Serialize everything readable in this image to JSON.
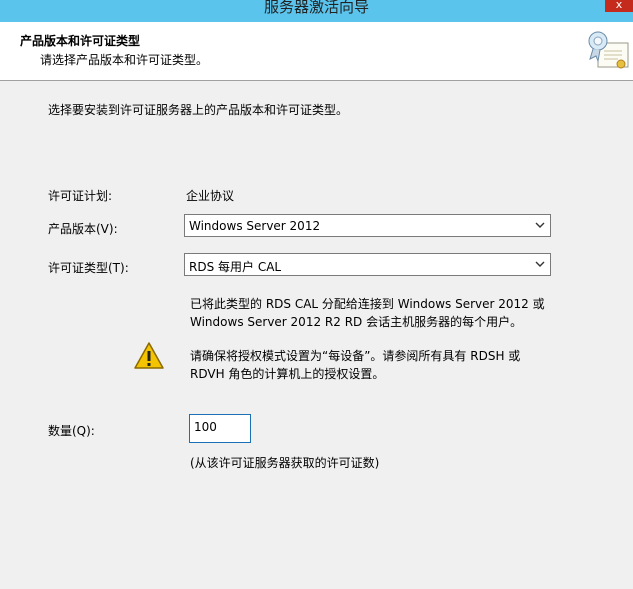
{
  "window": {
    "title": "服务器激活向导",
    "close": "x"
  },
  "header": {
    "title": "产品版本和许可证类型",
    "subtitle": "请选择产品版本和许可证类型。"
  },
  "description": "选择要安装到许可证服务器上的产品版本和许可证类型。",
  "license_program": {
    "label": "许可证计划:",
    "value": "企业协议"
  },
  "product_version": {
    "label": "产品版本(V):",
    "value": "Windows Server 2012"
  },
  "license_type": {
    "label": "许可证类型(T):",
    "value": "RDS 每用户 CAL"
  },
  "info": {
    "line1": "已将此类型的 RDS CAL 分配给连接到 Windows Server 2012 或",
    "line2": "Windows Server 2012 R2 RD 会话主机服务器的每个用户。"
  },
  "warning": {
    "line1": "请确保将授权模式设置为“每设备”。请参阅所有具有 RDSH 或",
    "line2": "RDVH 角色的计算机上的授权设置。"
  },
  "quantity": {
    "label": "数量(Q):",
    "value": "100",
    "hint": "(从该许可证服务器获取的许可证数)"
  }
}
